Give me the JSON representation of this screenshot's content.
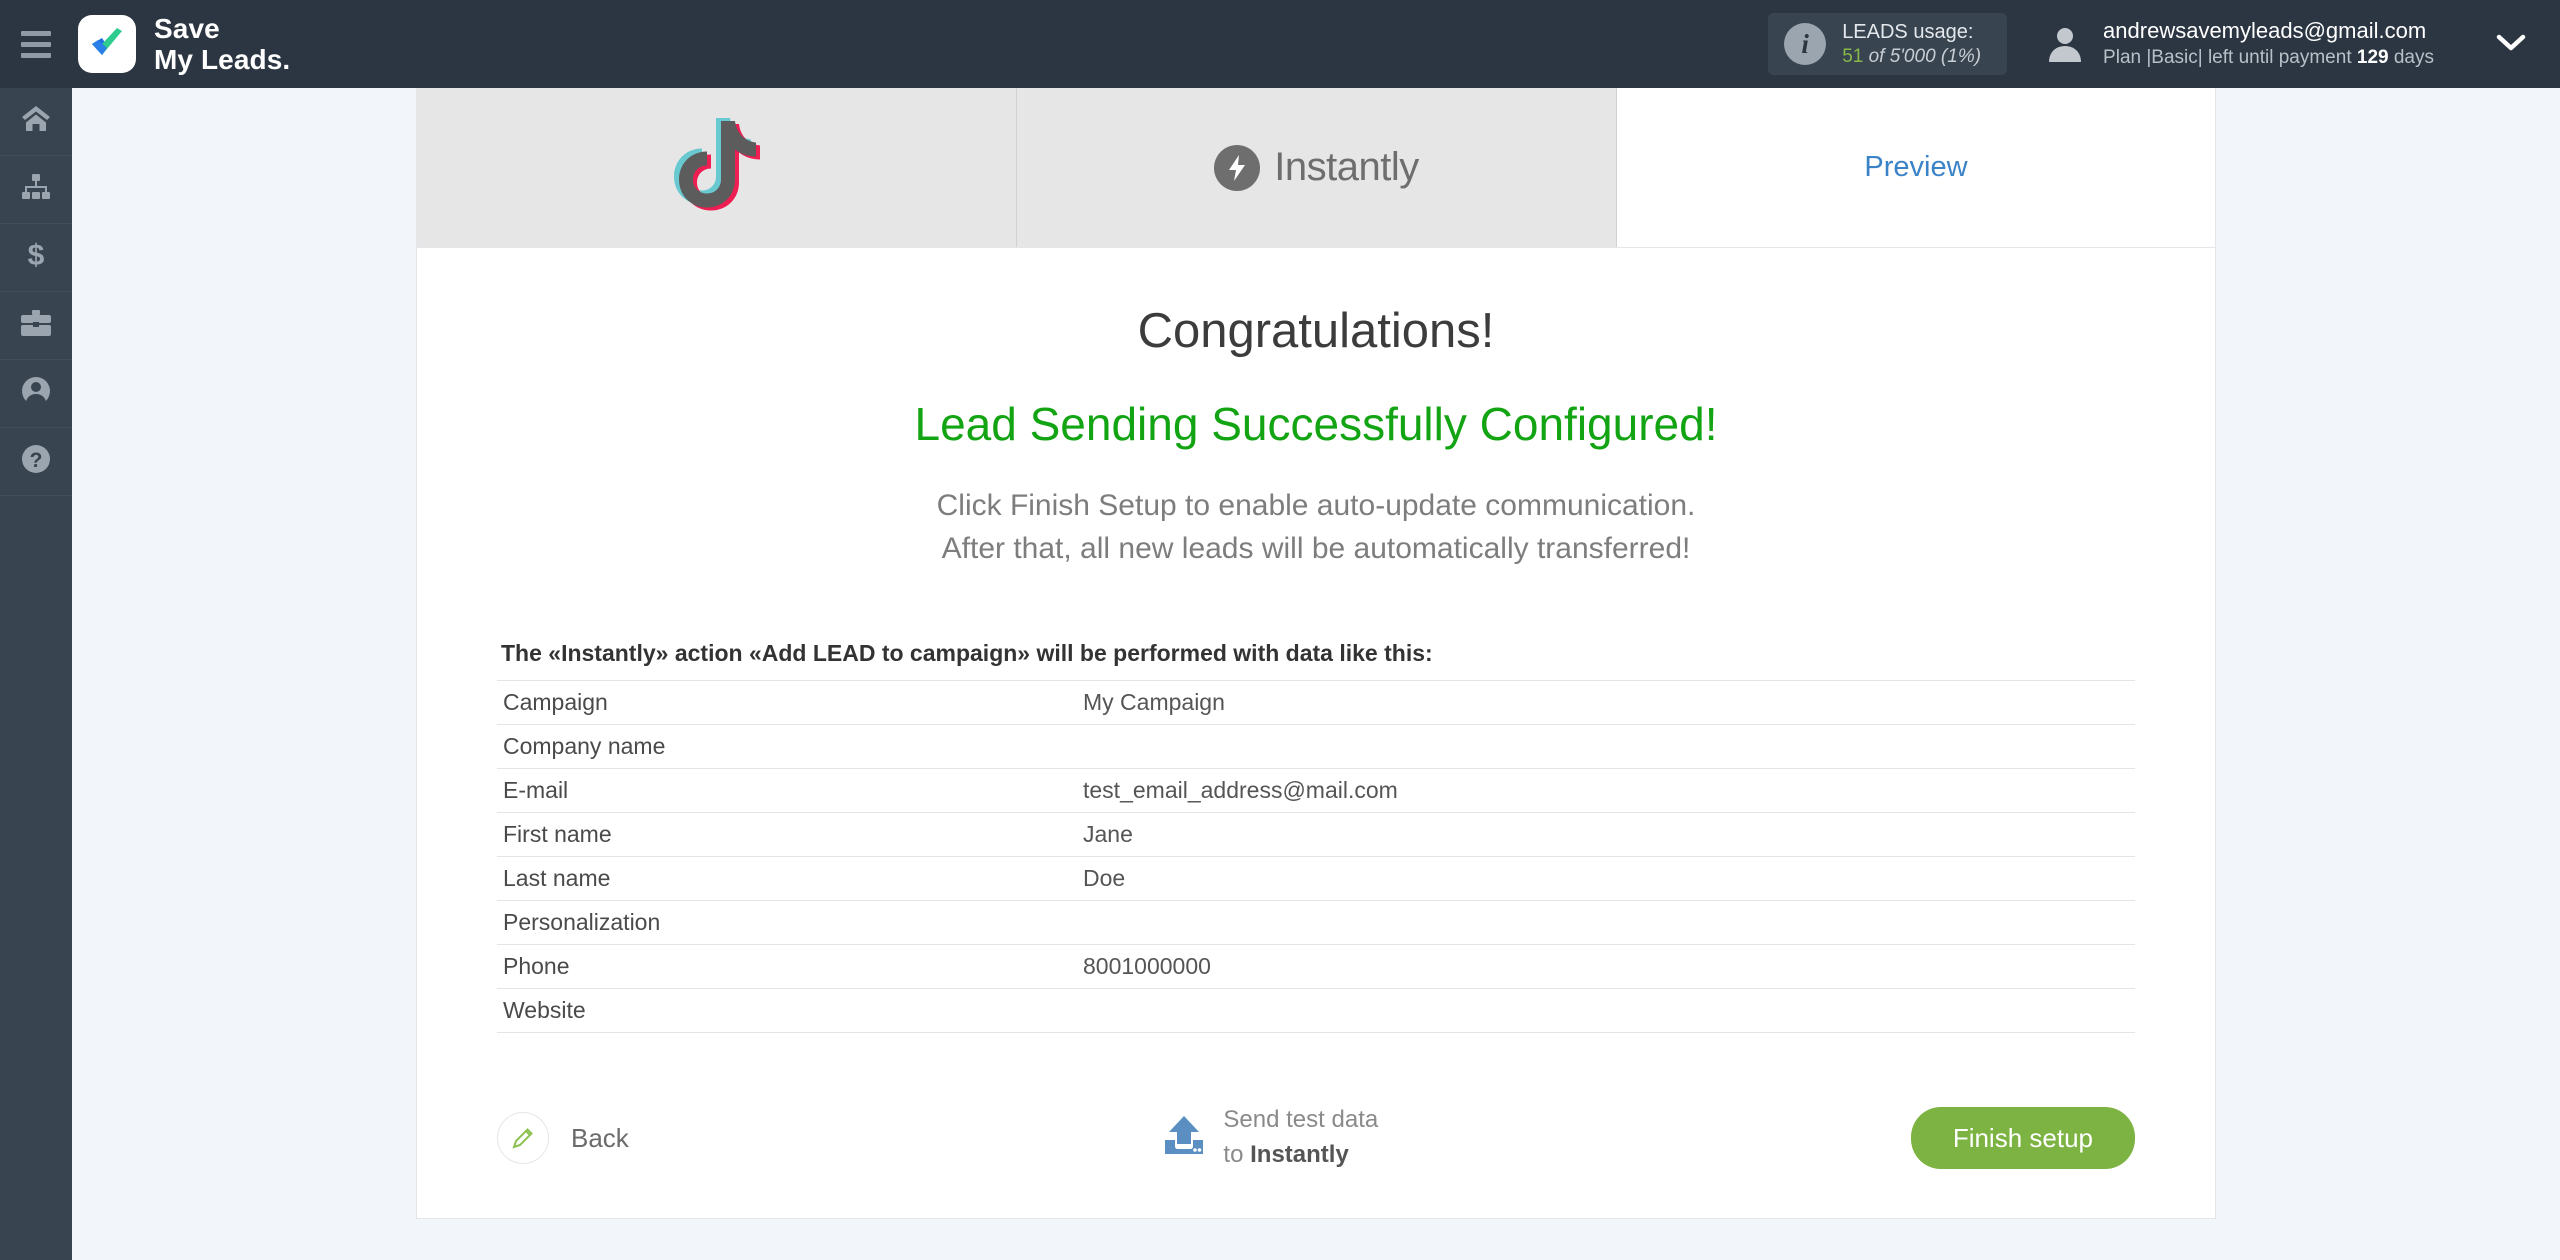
{
  "header": {
    "menu_icon": "hamburger-icon",
    "brand": "Save\nMy Leads.",
    "leads_usage": {
      "info_icon": "info-icon",
      "title": "LEADS usage:",
      "used": "51",
      "of": " of ",
      "limit": "5'000",
      "percent": "(1%)"
    },
    "account": {
      "avatar_icon": "user-avatar-icon",
      "email": "andrewsavemyleads@gmail.com",
      "plan_prefix": "Plan |Basic| left until payment ",
      "days": "129",
      "plan_suffix": " days",
      "chevron_icon": "chevron-down-icon"
    }
  },
  "sidebar": {
    "items": [
      {
        "name": "home",
        "icon": "home-icon"
      },
      {
        "name": "connections",
        "icon": "sitemap-icon"
      },
      {
        "name": "billing",
        "icon": "dollar-icon"
      },
      {
        "name": "business",
        "icon": "briefcase-icon"
      },
      {
        "name": "profile",
        "icon": "user-circle-icon"
      },
      {
        "name": "help",
        "icon": "question-circle-icon"
      }
    ]
  },
  "tabs": [
    {
      "label": "",
      "icon": "tiktok-logo-icon",
      "active": false
    },
    {
      "label": "Instantly",
      "icon": "instantly-logo-icon",
      "active": false
    },
    {
      "label": "Preview",
      "icon": "",
      "active": true
    }
  ],
  "main": {
    "title": "Congratulations!",
    "subtitle": "Lead Sending Successfully Configured!",
    "hint": "Click Finish Setup to enable auto-update communication.\nAfter that, all new leads will be automatically transferred!",
    "table_intro": "The «Instantly» action «Add LEAD to campaign» will be performed with data like this:",
    "table": {
      "rows": [
        {
          "field": "Campaign",
          "value": "My Campaign"
        },
        {
          "field": "Company name",
          "value": ""
        },
        {
          "field": "E-mail",
          "value": "test_email_address@mail.com"
        },
        {
          "field": "First name",
          "value": "Jane"
        },
        {
          "field": "Last name",
          "value": "Doe"
        },
        {
          "field": "Personalization",
          "value": ""
        },
        {
          "field": "Phone",
          "value": "8001000000"
        },
        {
          "field": "Website",
          "value": ""
        }
      ]
    }
  },
  "footer": {
    "back_label": "Back",
    "back_icon": "pencil-icon",
    "send_test_icon": "upload-icon",
    "send_test_line1": "Send test data",
    "send_test_line2_prefix": "to ",
    "send_test_line2_target": "Instantly",
    "finish_label": "Finish setup"
  },
  "colors": {
    "header_bg": "#2b3642",
    "rail_bg": "#38444f",
    "page_bg": "#f2f5fa",
    "success_green": "#13a413",
    "accent_blue": "#3b83c7",
    "finish_green": "#7cb342",
    "usage_green": "#86b94a"
  }
}
